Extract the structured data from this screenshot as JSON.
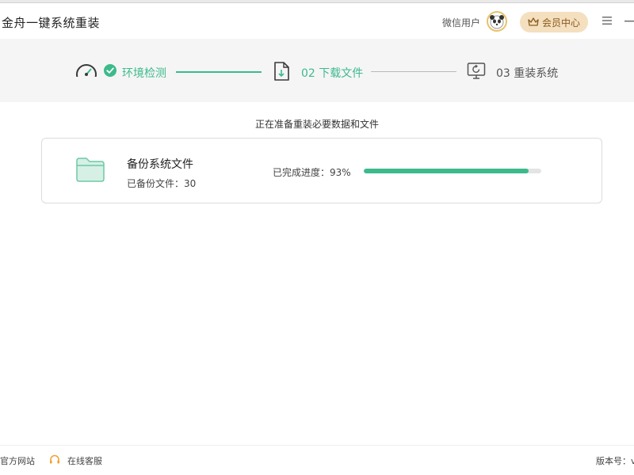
{
  "app": {
    "title": "金舟一键系统重装"
  },
  "header": {
    "user_label": "微信用户",
    "vip_button": "会员中心"
  },
  "steps": [
    {
      "label": "环境检测",
      "state": "done"
    },
    {
      "label": "02 下载文件",
      "state": "active"
    },
    {
      "label": "03 重装系统",
      "state": "pending"
    }
  ],
  "main": {
    "status": "正在准备重装必要数据和文件",
    "task": {
      "title": "备份系统文件",
      "backed_up": "已备份文件：30",
      "progress_label": "已完成进度：93%",
      "progress_percent": 93
    }
  },
  "footer": {
    "official_site": "官方网站",
    "online_service": "在线客服",
    "version": "版本号：v"
  },
  "colors": {
    "accent": "#3dba8c",
    "vip_bg": "#f4dfbf",
    "vip_text": "#8a5a1c"
  },
  "icons": {
    "gauge": "gauge-icon",
    "check": "check-circle-icon",
    "download": "download-file-icon",
    "monitor": "monitor-refresh-icon",
    "folder": "folder-icon",
    "headset": "headset-icon",
    "menu": "menu-icon",
    "minimize": "minimize-icon",
    "crown": "crown-icon"
  }
}
